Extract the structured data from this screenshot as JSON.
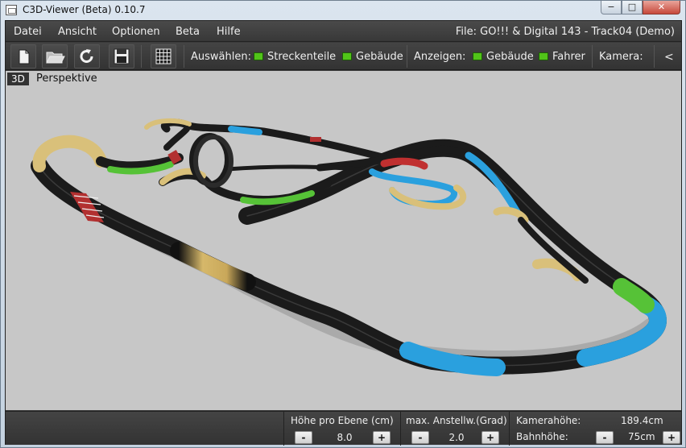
{
  "window": {
    "title": "C3D-Viewer (Beta) 0.10.7",
    "minimize": "−",
    "maximize": "□",
    "close": "✕"
  },
  "menubar": {
    "items": [
      "Datei",
      "Ansicht",
      "Optionen",
      "Beta",
      "Hilfe"
    ],
    "file_label": "File: GO!!! & Digital 143 - Track04 (Demo)"
  },
  "toolbar": {
    "buttons": [
      "new-document-icon",
      "open-folder-icon",
      "reload-icon",
      "save-icon",
      "grid-icon"
    ],
    "select_label": "Auswählen:",
    "select_options": [
      "Streckenteile",
      "Gebäude"
    ],
    "show_label": "Anzeigen:",
    "show_options": [
      "Gebäude",
      "Fahrer"
    ],
    "camera_label": "Kamera:",
    "collapse": "<",
    "check_color": "#51c419"
  },
  "viewport": {
    "tag": "3D",
    "mode": "Perspektive",
    "background": "#c7c7c7"
  },
  "status": {
    "level_height_label": "Höhe pro Ebene (cm)",
    "level_height_value": "8.0",
    "max_angle_label": "max. Anstellw.(Grad)",
    "max_angle_value": "2.0",
    "camera_height_label": "Kamerahöhe:",
    "camera_height_value": "189.4cm",
    "track_height_label": "Bahnhöhe:",
    "track_height_value": "75cm",
    "minus": "-",
    "plus": "+"
  }
}
